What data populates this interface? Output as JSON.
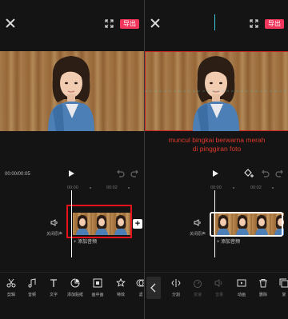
{
  "left_screen": {
    "export_label": "导出",
    "time_display": "00:00/00:05",
    "ruler": [
      "00:00",
      "00:02"
    ],
    "mute_label": "关闭原声",
    "add_audio_label": "+ 添加音频",
    "add_clip_symbol": "+",
    "toolbar": [
      {
        "label": "剪辑",
        "icon": "scissors-icon"
      },
      {
        "label": "音频",
        "icon": "music-note-icon"
      },
      {
        "label": "文字",
        "icon": "text-icon"
      },
      {
        "label": "添加贴纸",
        "icon": "sticker-icon"
      },
      {
        "label": "画中画",
        "icon": "picture-in-picture-icon"
      },
      {
        "label": "特效",
        "icon": "effects-star-icon"
      },
      {
        "label": "滤",
        "icon": "filter-icon"
      }
    ]
  },
  "right_screen": {
    "export_label": "导出",
    "annotation": [
      "muncul bingkai berwarna merah",
      "di pinggiran foto"
    ],
    "ruler": [
      "00:00",
      "00:02"
    ],
    "mute_label": "关闭原声",
    "add_audio_label": "+ 添加音频",
    "add_clip_symbol": "+",
    "toolbar": [
      {
        "label": "分割",
        "icon": "split-icon",
        "enabled": true
      },
      {
        "label": "变速",
        "icon": "speed-icon",
        "enabled": false
      },
      {
        "label": "音量",
        "icon": "volume-icon",
        "enabled": false
      },
      {
        "label": "动画",
        "icon": "animation-icon",
        "enabled": true
      },
      {
        "label": "删除",
        "icon": "trash-icon",
        "enabled": true
      },
      {
        "label": "复",
        "icon": "copy-icon",
        "enabled": true
      }
    ]
  },
  "colors": {
    "accent": "#f2355b",
    "annotation": "#e03a2c",
    "selection_frame": "#e8121a",
    "playhead_cyan": "#3cc8d8"
  }
}
